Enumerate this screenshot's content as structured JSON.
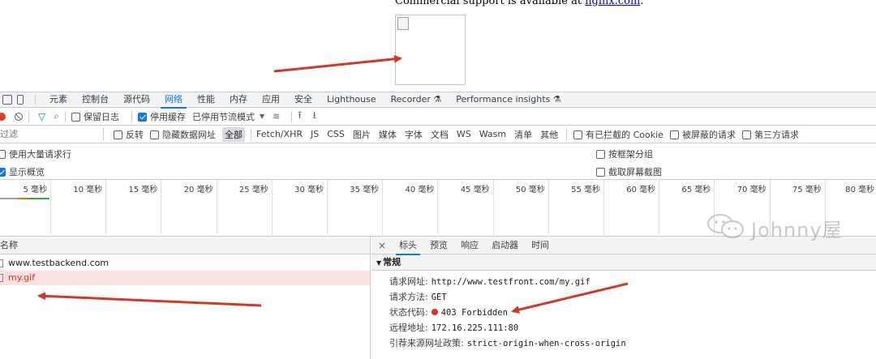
{
  "page": {
    "support_text": "Commercial support is available at ",
    "support_link": "nginx.com",
    "support_tail": "."
  },
  "devtools": {
    "tabs": [
      "元素",
      "控制台",
      "源代码",
      "网络",
      "性能",
      "内存",
      "应用",
      "安全",
      "Lighthouse",
      "Recorder ⚗",
      "Performance insights ⚗"
    ],
    "toolbar": {
      "preserve_log": "保留日志",
      "disable_cache": "停用缓存",
      "throttling": "已停用节流模式"
    },
    "filter": {
      "placeholder": "过滤",
      "invert": "反转",
      "hide_data_urls": "隐藏数据网址",
      "types": [
        "全部",
        "Fetch/XHR",
        "JS",
        "CSS",
        "图片",
        "媒体",
        "字体",
        "文档",
        "WS",
        "Wasm",
        "清单",
        "其他"
      ],
      "blocked_cookies": "有已拦截的 Cookie",
      "blocked_requests": "被屏蔽的请求",
      "third_party": "第三方请求"
    },
    "options": {
      "large_rows": "使用大量请求行",
      "show_overview": "显示概览",
      "group_by_frame": "按框架分组",
      "capture_screenshots": "截取屏幕截图"
    },
    "timeline_ticks": [
      "5 毫秒",
      "10 毫秒",
      "15 毫秒",
      "20 毫秒",
      "25 毫秒",
      "30 毫秒",
      "35 毫秒",
      "40 毫秒",
      "45 毫秒",
      "50 毫秒",
      "55 毫秒",
      "60 毫秒",
      "65 毫秒",
      "70 毫秒",
      "75 毫秒",
      "80 毫秒"
    ],
    "requests": {
      "header": "名称",
      "rows": [
        {
          "name": "www.testbackend.com",
          "error": false
        },
        {
          "name": "my.gif",
          "error": true
        }
      ]
    },
    "details": {
      "tabs": [
        "标头",
        "预览",
        "响应",
        "启动器",
        "时间"
      ],
      "section": "常规",
      "rows": [
        {
          "key": "请求网址:",
          "value": "http://www.testfront.com/my.gif"
        },
        {
          "key": "请求方法:",
          "value": "GET"
        },
        {
          "key": "状态代码:",
          "value": "403 Forbidden"
        },
        {
          "key": "远程地址:",
          "value": "172.16.225.111:80"
        },
        {
          "key": "引荐来源网址政策:",
          "value": "strict-origin-when-cross-origin"
        }
      ]
    }
  },
  "watermark": "Johnny屋",
  "colors": {
    "accent": "#1a73e8",
    "error": "#d93025",
    "arrow": "#d2372b"
  }
}
